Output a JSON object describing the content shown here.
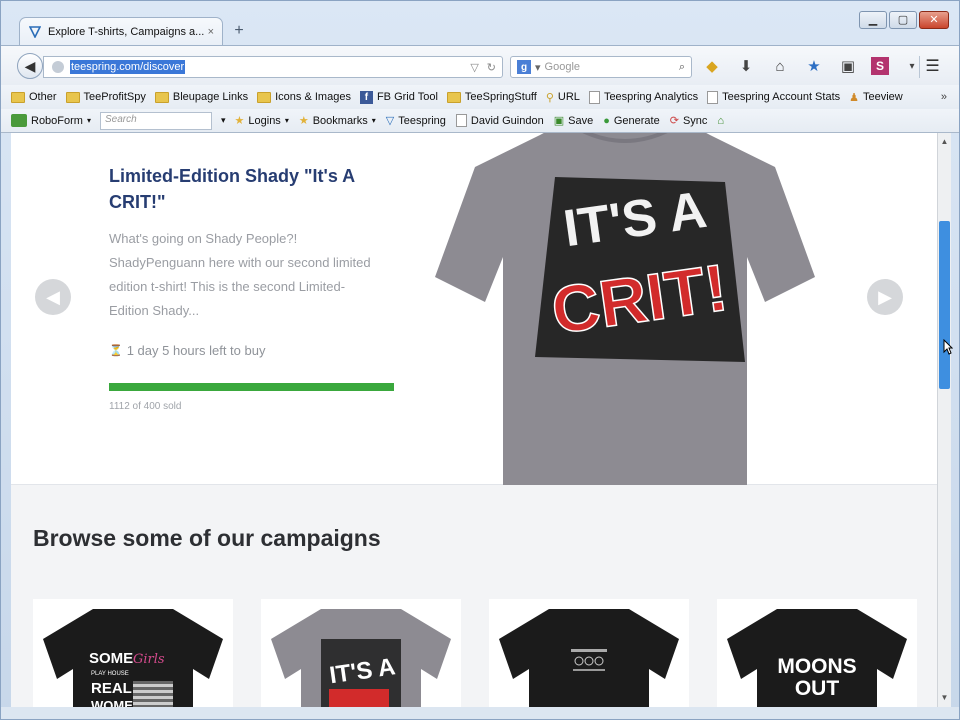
{
  "browser": {
    "tab_title": "Explore T-shirts, Campaigns a...",
    "tab_close": "×",
    "new_tab": "+",
    "url": "teespring.com/discover",
    "search_placeholder": "Google",
    "window_controls": {
      "minimize": "▁",
      "maximize": "▢",
      "close": "✕"
    }
  },
  "bookmarks_bar": {
    "items": [
      {
        "label": "Other",
        "icon": "folder-icon"
      },
      {
        "label": "TeeProfitSpy",
        "icon": "folder-icon"
      },
      {
        "label": "Bleupage Links",
        "icon": "folder-icon"
      },
      {
        "label": "Icons & Images",
        "icon": "folder-icon"
      },
      {
        "label": "FB Grid Tool",
        "icon": "facebook-icon"
      },
      {
        "label": "TeeSpringStuff",
        "icon": "folder-icon"
      },
      {
        "label": "URL",
        "icon": "link-icon"
      },
      {
        "label": "Teespring Analytics",
        "icon": "page-icon"
      },
      {
        "label": "Teespring Account Stats",
        "icon": "page-icon"
      },
      {
        "label": "Teeview",
        "icon": "person-icon"
      }
    ],
    "more": "»"
  },
  "roboform_bar": {
    "roboform_label": "RoboForm",
    "search_placeholder": "Search",
    "items": [
      {
        "label": "Logins",
        "icon": "star-icon"
      },
      {
        "label": "Bookmarks",
        "icon": "star-icon"
      },
      {
        "label": "Teespring",
        "icon": "teespring-icon"
      },
      {
        "label": "David Guindon",
        "icon": "page-icon"
      },
      {
        "label": "Save",
        "icon": "save-icon"
      },
      {
        "label": "Generate",
        "icon": "generate-icon"
      },
      {
        "label": "Sync",
        "icon": "sync-icon"
      }
    ]
  },
  "hero": {
    "title": "Limited-Edition Shady \"It's A CRIT!\"",
    "description": "What's going on Shady People?! ShadyPenguann here with our second limited edition t-shirt! This is the second Limited-Edition Shady...",
    "time_left": "1 day 5 hours left to buy",
    "sold_text": "1112 of 400 sold",
    "progress": 1.0,
    "shirt_text_top": "IT'S A",
    "shirt_text_bottom": "CRIT!",
    "colors": {
      "title": "#273d72",
      "progress": "#3aa83d",
      "shirt": "#8d8b92",
      "accent_red": "#d22b2b"
    }
  },
  "browse": {
    "heading": "Browse some of our campaigns",
    "cards": [
      {
        "shirt_color": "#1b1b1b",
        "text_line1": "SOME",
        "text_line2": "REAL",
        "text_line3": "WOMEN",
        "script": "Girls",
        "small": "PLAY HOUSE"
      },
      {
        "shirt_color": "#8d8b92",
        "text_line1": "IT'S A"
      },
      {
        "shirt_color": "#1b1b1b"
      },
      {
        "shirt_color": "#1b1b1b",
        "text_line1": "MOONS",
        "text_line2": "OUT"
      }
    ]
  }
}
